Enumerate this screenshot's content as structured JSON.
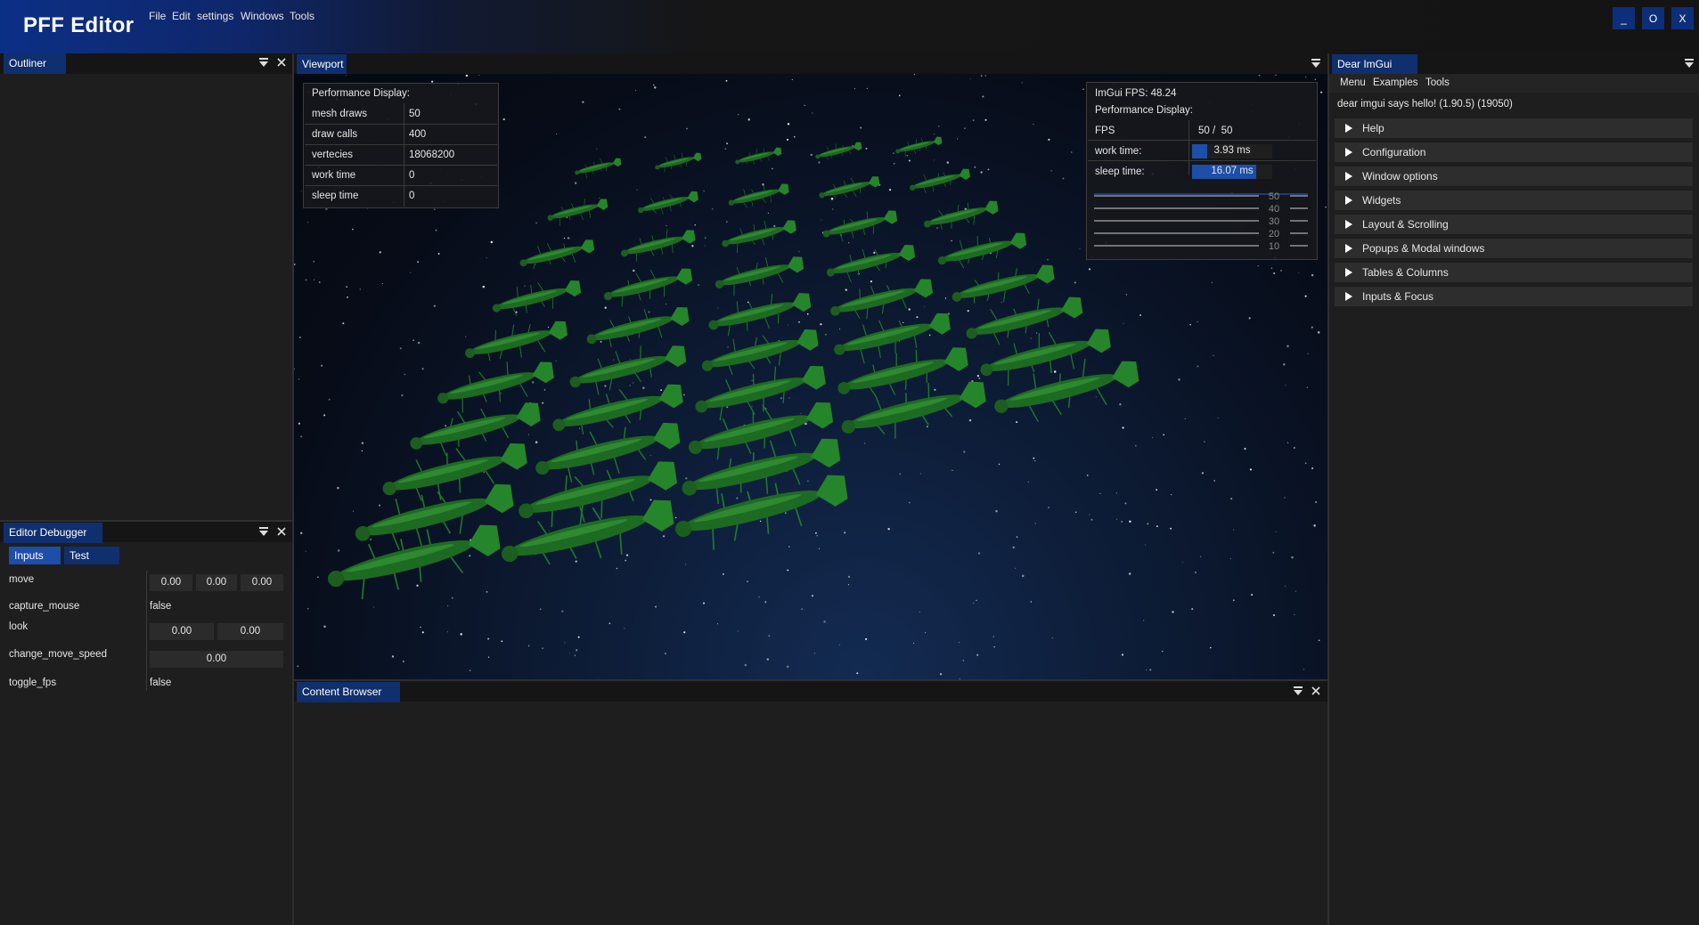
{
  "app": {
    "title": "PFF Editor"
  },
  "menubar": [
    "File",
    "Edit",
    "settings",
    "Windows",
    "Tools"
  ],
  "window_controls": {
    "minimize": "_",
    "maximize": "O",
    "close": "X"
  },
  "colors": {
    "accent": "#0f2f6e",
    "button": "#0d2e7a",
    "panel_bg": "#1e1e1e",
    "bar_fill": "#1d4ea8"
  },
  "outliner": {
    "title": "Outliner",
    "icons": [
      "collapse-icon",
      "close-icon"
    ]
  },
  "viewport": {
    "title": "Viewport",
    "perf_left": {
      "heading": "Performance Display:",
      "rows": [
        {
          "label": "mesh draws",
          "value": "50"
        },
        {
          "label": "draw calls",
          "value": "400"
        },
        {
          "label": "vertecies",
          "value": "18068200"
        },
        {
          "label": "work time",
          "value": "0"
        },
        {
          "label": "sleep time",
          "value": "0"
        }
      ]
    },
    "perf_right": {
      "fps_line": "ImGui FPS: 48.24",
      "heading": "Performance Display:",
      "fps_label": "FPS",
      "fps_value": "50 /  50",
      "work_label": "work time:",
      "work_value": "3.93 ms",
      "work_fraction": 0.19,
      "sleep_label": "sleep time:",
      "sleep_value": "16.07 ms",
      "sleep_fraction": 0.8,
      "graph_ticks": [
        "50",
        "40",
        "30",
        "20",
        "10"
      ]
    }
  },
  "content_browser": {
    "title": "Content Browser"
  },
  "editor_debugger": {
    "title": "Editor Debugger",
    "tabs": [
      "Inputs",
      "Test"
    ],
    "rows": [
      {
        "label": "move",
        "values": [
          "0.00",
          "0.00",
          "0.00"
        ]
      },
      {
        "label": "capture_mouse",
        "text": "false"
      },
      {
        "label": "look",
        "values": [
          "0.00",
          "0.00"
        ]
      },
      {
        "label": "change_move_speed",
        "values": [
          "0.00"
        ]
      },
      {
        "label": "toggle_fps",
        "text": "false"
      }
    ]
  },
  "imgui_demo": {
    "title": "Dear ImGui Demo",
    "menu": [
      "Menu",
      "Examples",
      "Tools"
    ],
    "hello": "dear imgui says hello! (1.90.5) (19050)",
    "sections": [
      "Help",
      "Configuration",
      "Window options",
      "Widgets",
      "Layout & Scrolling",
      "Popups & Modal windows",
      "Tables & Columns",
      "Inputs & Focus"
    ]
  }
}
